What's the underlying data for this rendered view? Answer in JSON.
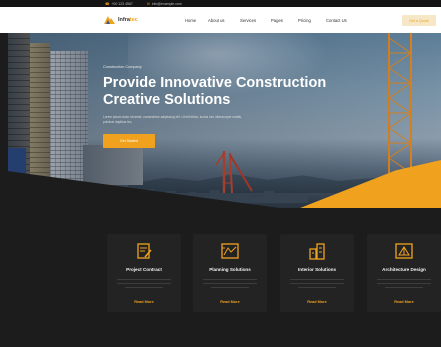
{
  "topbar": {
    "phone": "+00 123 4567",
    "email": "info@example.com"
  },
  "brand": {
    "name_prefix": "Infra",
    "name_suffix": "tec",
    "accent_color": "#f0a21f"
  },
  "nav": {
    "items": [
      "Home",
      "About us",
      "Services",
      "Pages",
      "Pricing",
      "Contact Us"
    ],
    "cta_label": "Get a Quote"
  },
  "hero": {
    "kicker": "Construction Company",
    "title": "Provide Innovative Construction Creative Solutions",
    "description": "Lorem ipsum dolor sit amet, consectetur adipiscing elit. Ut elit tellus, luctus nec ullamcorper mattis, pulvinar dapibus leo.",
    "button_label": "Get Started"
  },
  "services": [
    {
      "title": "Project Contract",
      "link_label": "Read More",
      "icon": "document-pen-icon"
    },
    {
      "title": "Planning Solutions",
      "link_label": "Read More",
      "icon": "blueprint-icon"
    },
    {
      "title": "Interior Solutions",
      "link_label": "Read More",
      "icon": "buildings-icon"
    },
    {
      "title": "Architecture Design",
      "link_label": "Read More",
      "icon": "architecture-icon"
    }
  ]
}
